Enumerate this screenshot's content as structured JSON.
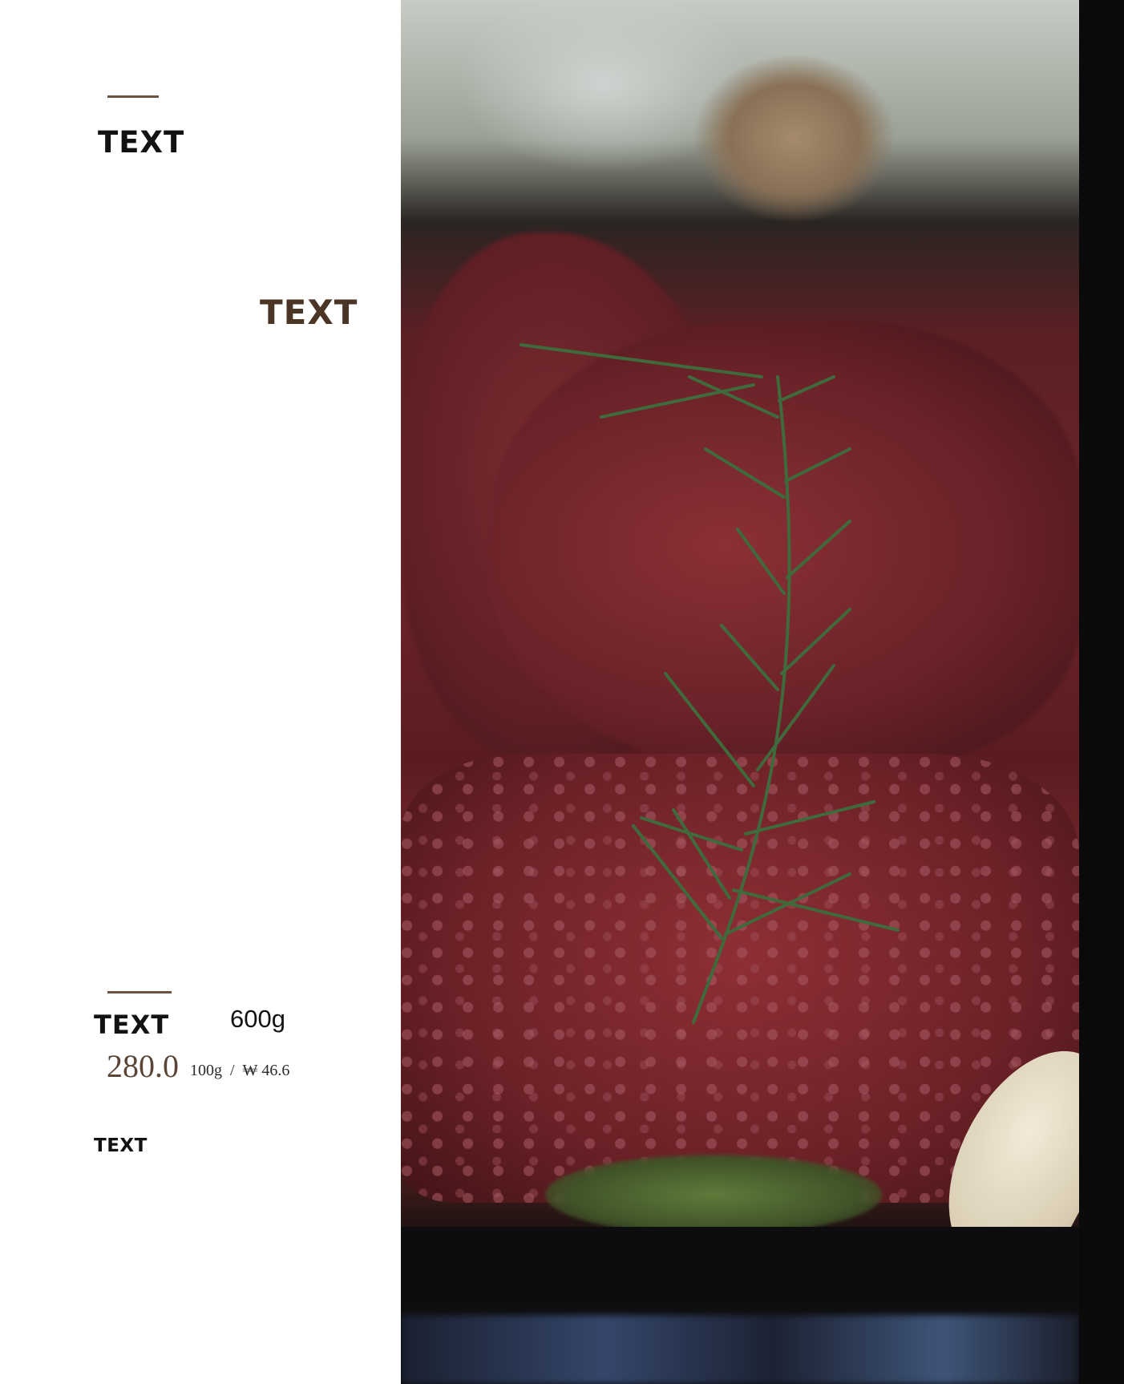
{
  "header": {
    "title": "TEXT",
    "subtitle": "TEXT"
  },
  "item": {
    "name": "TEXT",
    "weight": "600g",
    "price": "280.0",
    "unit_price": "100g  /  ₩ 46.6",
    "note": "TEXT"
  },
  "colors": {
    "accent_brown": "#4a3527",
    "rule": "#6b5342",
    "text_dark": "#121212"
  },
  "photo": {
    "subject": "raw-marbled-steak-with-rosemary-image"
  }
}
